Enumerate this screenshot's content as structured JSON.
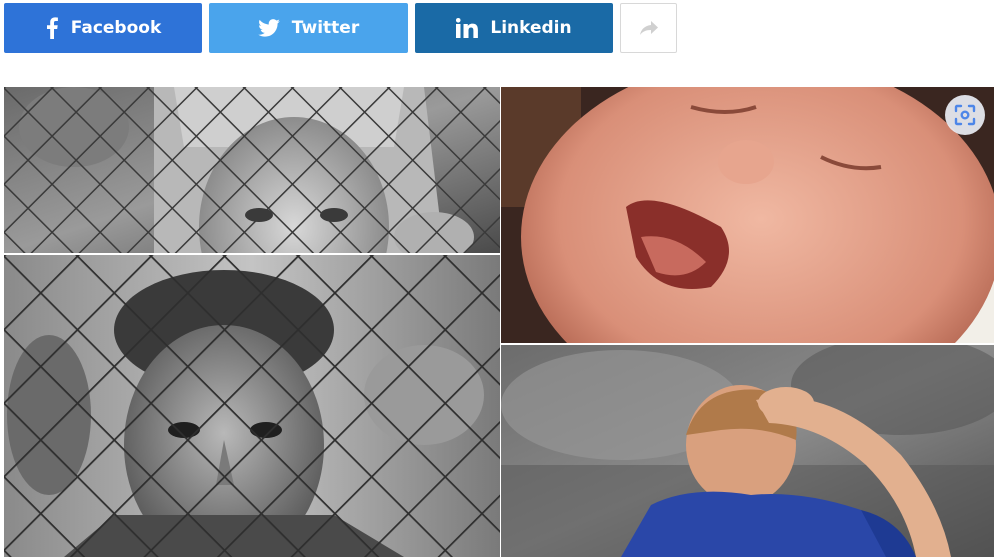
{
  "share": {
    "facebook_label": "Facebook",
    "twitter_label": "Twitter",
    "linkedin_label": "Linkedin",
    "colors": {
      "facebook": "#2e73d8",
      "twitter": "#4aa4ec",
      "linkedin": "#1a6aa6"
    },
    "icons": {
      "facebook": "facebook-icon",
      "twitter": "twitter-icon",
      "linkedin": "linkedin-icon",
      "more": "share-arrow-icon"
    }
  },
  "collage": {
    "photos": [
      {
        "subject": "girl-behind-fence",
        "tone": "grayscale"
      },
      {
        "subject": "boy-behind-fence",
        "tone": "grayscale"
      },
      {
        "subject": "crying-baby",
        "tone": "color"
      },
      {
        "subject": "child-holding-head",
        "tone": "color"
      }
    ]
  },
  "overlay": {
    "icon": "visual-search-icon"
  }
}
